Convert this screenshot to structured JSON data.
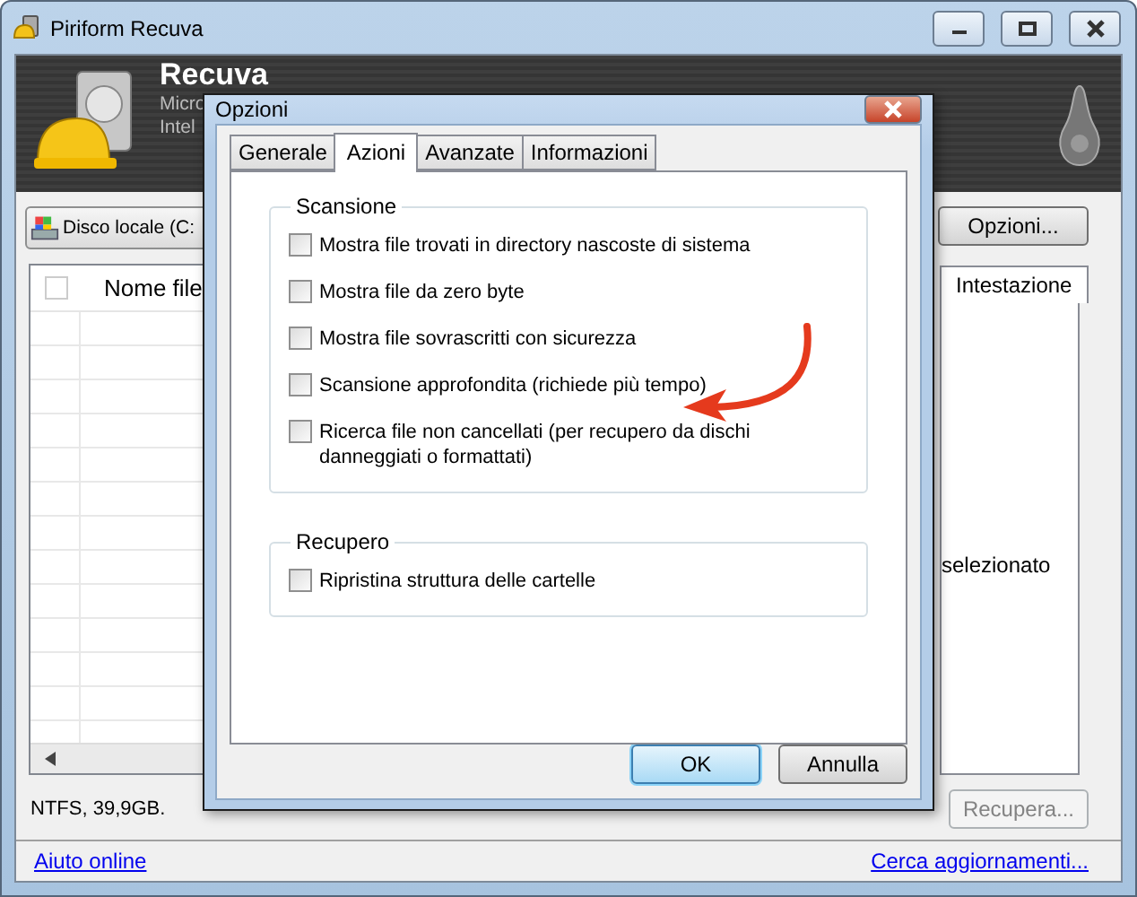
{
  "window": {
    "title": "Piriform Recuva"
  },
  "header": {
    "app_name": "Recuva",
    "lines": [
      "Micro",
      "Intel"
    ]
  },
  "drive_selector": {
    "value": "Disco locale (C:"
  },
  "options_button": {
    "label": "Opzioni..."
  },
  "file_list": {
    "columns": [
      "Nome file"
    ],
    "header_checked": false
  },
  "details_tabs": [
    {
      "label": "Intestazione",
      "selected": true
    }
  ],
  "details_text": "selezionato",
  "status_text": "NTFS, 39,9GB.",
  "recover_button": {
    "label": "Recupera...",
    "disabled": true
  },
  "footer_links": [
    "Aiuto online",
    "Cerca aggiornamenti..."
  ],
  "dialog": {
    "title": "Opzioni",
    "tabs": [
      {
        "label": "Generale",
        "selected": false
      },
      {
        "label": "Azioni",
        "selected": true
      },
      {
        "label": "Avanzate",
        "selected": false
      },
      {
        "label": "Informazioni",
        "selected": false
      }
    ],
    "groups": [
      {
        "title": "Scansione",
        "options": [
          {
            "label": "Mostra file trovati in directory nascoste di sistema",
            "checked": false
          },
          {
            "label": "Mostra file da zero byte",
            "checked": false
          },
          {
            "label": "Mostra file sovrascritti con sicurezza",
            "checked": false
          },
          {
            "label": "Scansione approfondita (richiede più tempo)",
            "checked": false
          },
          {
            "label": "Ricerca file non cancellati (per recupero da dischi danneggiati o formattati)",
            "checked": false
          }
        ]
      },
      {
        "title": "Recupero",
        "options": [
          {
            "label": "Ripristina struttura delle cartelle",
            "checked": false
          }
        ]
      }
    ],
    "buttons": [
      {
        "label": "OK",
        "default": true
      },
      {
        "label": "Annulla",
        "default": false
      }
    ]
  }
}
